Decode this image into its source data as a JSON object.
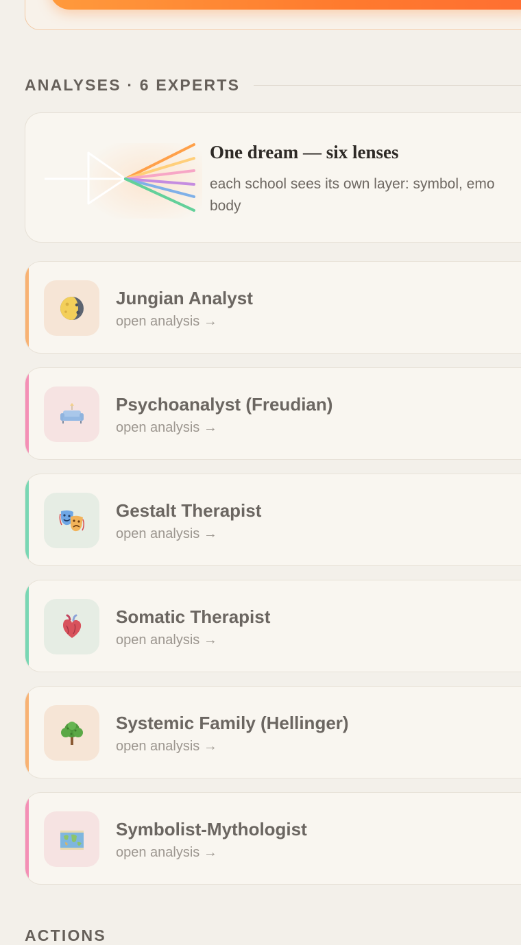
{
  "section": {
    "title": "ANALYSES · 6 EXPERTS"
  },
  "lens_card": {
    "title": "One dream — six lenses",
    "subtitle": "each school sees its own layer: symbol, emo body",
    "subtitle_line1": "each school sees its own layer: symbol, emo",
    "subtitle_line2": "body",
    "ray_colors": [
      "#ffa049",
      "#ffcf7a",
      "#f7a6c6",
      "#c58ce0",
      "#7fb0e8",
      "#63d09a"
    ]
  },
  "experts": [
    {
      "name": "Jungian Analyst",
      "link": "open analysis →",
      "icon": "moon-icon",
      "accent": "#f8b273",
      "tile": "#f6e5d6"
    },
    {
      "name": "Psychoanalyst (Freudian)",
      "link": "open analysis →",
      "icon": "couch-icon",
      "accent": "#f48fb6",
      "tile": "#f6e3e2"
    },
    {
      "name": "Gestalt Therapist",
      "link": "open analysis →",
      "icon": "theater-masks-icon",
      "accent": "#78d7b4",
      "tile": "#e6ede4"
    },
    {
      "name": "Somatic Therapist",
      "link": "open analysis →",
      "icon": "heart-icon",
      "accent": "#78d7b4",
      "tile": "#e6ede4"
    },
    {
      "name": "Systemic Family (Hellinger)",
      "link": "open analysis →",
      "icon": "tree-icon",
      "accent": "#f8b273",
      "tile": "#f6e5d6"
    },
    {
      "name": "Symbolist-Mythologist",
      "link": "open analysis →",
      "icon": "map-icon",
      "accent": "#f48fb6",
      "tile": "#f6e3e2"
    }
  ],
  "footer": {
    "title": "ACTIONS"
  }
}
